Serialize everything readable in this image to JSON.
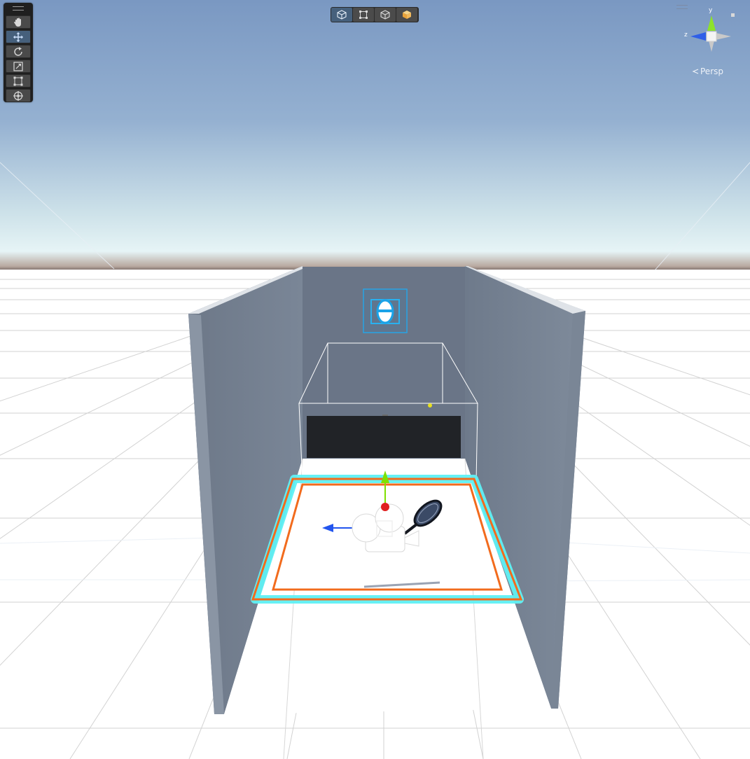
{
  "scene": {
    "view_mode_label": "Persp",
    "axis_labels": {
      "y": "y",
      "z": "z"
    },
    "colors": {
      "sky_top": "#7d9cc6",
      "horizon": "#dfeef2",
      "ground": "#ffffff",
      "grid_line": "#cfcfcf",
      "wall": "#6f7b8c",
      "selection_outline": "#f26b1d",
      "highlight_glow": "#5ff0f4",
      "gizmo_y": "#7fe000",
      "gizmo_x": "#e02020",
      "gizmo_z": "#2255ee"
    }
  },
  "tools": [
    {
      "name": "view-tool",
      "icon": "hand-icon",
      "active": false
    },
    {
      "name": "move-tool",
      "icon": "move-arrows-icon",
      "active": true
    },
    {
      "name": "rotate-tool",
      "icon": "rotate-icon",
      "active": false
    },
    {
      "name": "scale-tool",
      "icon": "scale-icon",
      "active": false
    },
    {
      "name": "rect-tool",
      "icon": "rect-transform-icon",
      "active": false
    },
    {
      "name": "transform-tool",
      "icon": "transform-icon",
      "active": false
    }
  ],
  "view_toolbar": [
    {
      "name": "view-option-1",
      "icon": "wireframe-cube-icon",
      "active": true
    },
    {
      "name": "view-option-2",
      "icon": "rect-icon",
      "active": false
    },
    {
      "name": "view-option-3",
      "icon": "cube-outline-icon",
      "active": false
    },
    {
      "name": "view-option-4",
      "icon": "shaded-cube-icon",
      "active": false
    }
  ]
}
